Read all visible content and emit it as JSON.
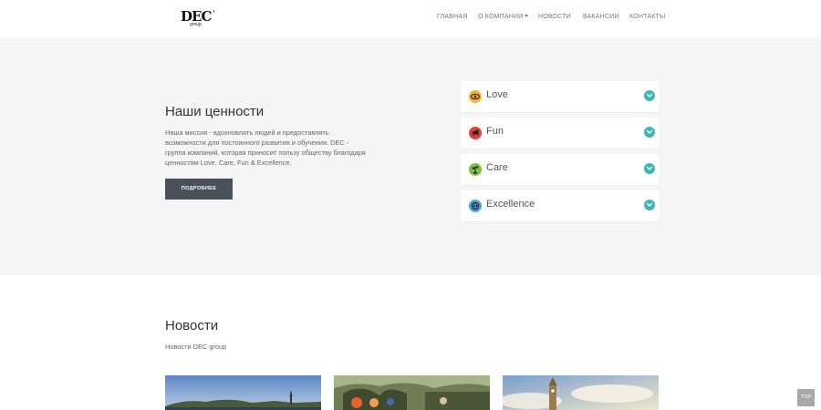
{
  "header": {
    "logo": {
      "main": "DEC",
      "sub": "group"
    },
    "nav": [
      {
        "label": "ГЛАВНАЯ"
      },
      {
        "label": "О КОМПАНИИ"
      },
      {
        "label": "НОВОСТИ"
      },
      {
        "label": "ВАКАНСИИ"
      },
      {
        "label": "КОНТАКТЫ"
      }
    ]
  },
  "values": {
    "title": "Наши ценности",
    "text": "Наша миссия - вдохновлять людей и предоставлять возможности для постоянного развития и обучения. DEC - группа компаний, которая приносит пользу обществу благодаря ценностям Love, Care, Fun & Excellence.",
    "button": "ПОДРОБНЕЕ",
    "items": [
      {
        "label": "Love",
        "icon": "eye-icon",
        "color": "#f5b335"
      },
      {
        "label": "Fun",
        "icon": "horn-icon",
        "color": "#e2403b"
      },
      {
        "label": "Care",
        "icon": "plant-icon",
        "color": "#7ac143"
      },
      {
        "label": "Excellence",
        "icon": "globe-icon",
        "color": "#4ba6dc"
      }
    ],
    "toggle_color": "#3fb5b5"
  },
  "news": {
    "title": "Новости",
    "subtitle": "Новости DEC group"
  },
  "top_button": "TOP"
}
